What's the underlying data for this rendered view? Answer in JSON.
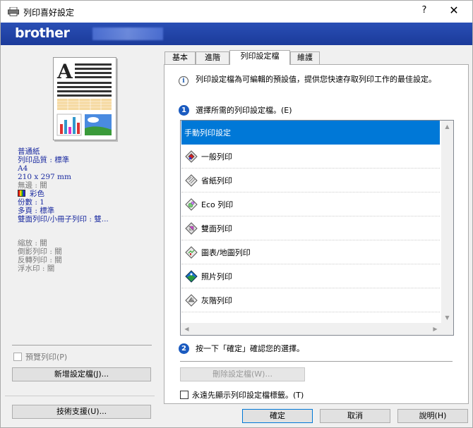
{
  "window": {
    "title": "列印喜好設定",
    "help_label": "?",
    "close_label": "✕",
    "brand": "brother"
  },
  "left": {
    "settings_primary": [
      "普通紙",
      "列印品質 : 標準",
      "A4",
      "210 x 297 mm"
    ],
    "staple": "無邊 : 關",
    "color": "彩色",
    "settings_secondary": [
      "份數 : 1",
      "多頁 : 標準",
      "雙面列印/小冊子列印 : 雙..."
    ],
    "settings_disabled": [
      "縮放 : 關",
      "倒影列印 : 關",
      "反轉列印 : 關",
      "浮水印 : 關"
    ],
    "preview_checkbox": "預覽列印(P)",
    "add_profile_button": "新增設定檔(J)...",
    "support_button": "技術支援(U)..."
  },
  "tabs": [
    {
      "label": "基本"
    },
    {
      "label": "進階"
    },
    {
      "label": "列印設定檔"
    },
    {
      "label": "維護"
    }
  ],
  "panel": {
    "description": "列印設定檔為可編輯的預設值，提供您快速存取列印工作的最佳設定。",
    "step1": "選擇所需的列印設定檔。(E)",
    "profiles": [
      {
        "label": "手動列印設定",
        "icon": "none"
      },
      {
        "label": "一般列印",
        "icon": "general-print-icon"
      },
      {
        "label": "省紙列印",
        "icon": "paper-saving-icon"
      },
      {
        "label": "Eco 列印",
        "icon": "eco-print-icon"
      },
      {
        "label": "雙面列印",
        "icon": "duplex-print-icon"
      },
      {
        "label": "圖表/地圖列印",
        "icon": "chart-map-print-icon"
      },
      {
        "label": "照片列印",
        "icon": "photo-print-icon"
      },
      {
        "label": "灰階列印",
        "icon": "grayscale-print-icon"
      }
    ],
    "step2": "按一下「確定」確認您的選擇。",
    "delete_button": "刪除設定檔(W)...",
    "always_show_checkbox": "永遠先顯示列印設定檔標籤。(T)"
  },
  "footer": {
    "ok": "確定",
    "cancel": "取消",
    "help": "說明(H)"
  },
  "colors": {
    "brand_blue": "#1b3a9a",
    "selection": "#0078d7",
    "info_blue": "#1a2aa0"
  }
}
